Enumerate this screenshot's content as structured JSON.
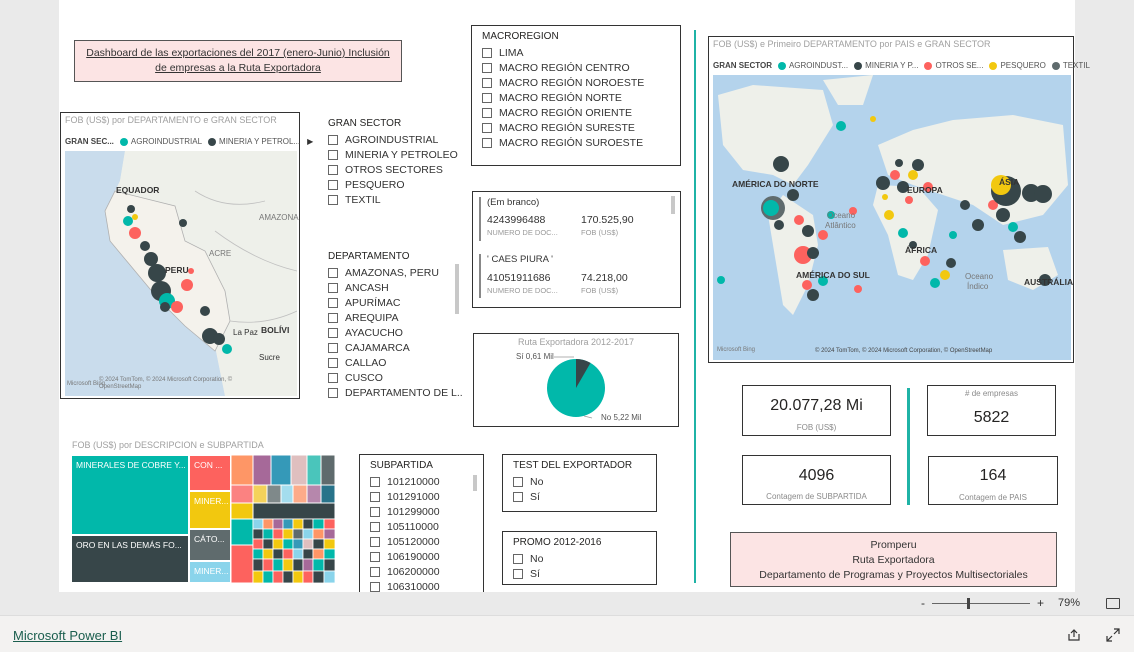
{
  "report": {
    "title_box": "Dashboard de las exportaciones del 2017 (enero-Junio) Inclusión de empresas a la Ruta Exportadora"
  },
  "dept_map": {
    "title": "FOB (US$) por DEPARTAMENTO e GRAN SECTOR",
    "legend_title": "GRAN SEC...",
    "legend": [
      {
        "label": "AGROINDUSTRIAL",
        "color": "#01b8aa"
      },
      {
        "label": "MINERIA Y PETROL...",
        "color": "#374649"
      }
    ],
    "labels": {
      "equador": "EQUADOR",
      "peru": "PERU",
      "bolivia": "BOLÍVI",
      "amazonas": "AMAZONA",
      "acre": "ACRE",
      "lapaz": "La Paz",
      "sucre": "Sucre",
      "lima": "Lima"
    },
    "copyright": "© 2024 TomTom, © 2024 Microsoft Corporation, © OpenStreetMap",
    "terms": "Terms",
    "brand": "Microsoft Bing"
  },
  "gran_sector": {
    "title": "GRAN SECTOR",
    "items": [
      "AGROINDUSTRIAL",
      "MINERIA Y PETROLEO",
      "OTROS SECTORES",
      "PESQUERO",
      "TEXTIL"
    ]
  },
  "departamento": {
    "title": "DEPARTAMENTO",
    "items": [
      "AMAZONAS, PERU",
      "ANCASH",
      "APURÍMAC",
      "AREQUIPA",
      "AYACUCHO",
      "CAJAMARCA",
      "CALLAO",
      "CUSCO",
      "DEPARTAMENTO DE L..."
    ]
  },
  "macroregion": {
    "title": "MACROREGION",
    "items": [
      "LIMA",
      "MACRO REGIÓN CENTRO",
      "MACRO REGIÓN NOROESTE",
      "MACRO REGIÓN NORTE",
      "MACRO REGIÓN ORIENTE",
      "MACRO REGIÓN SURESTE",
      "MACRO REGIÓN SUROESTE"
    ]
  },
  "company_list": {
    "groups": [
      {
        "header": "(Em branco)",
        "id": "4243996488",
        "id_label": "NUMERO DE DOC...",
        "fob": "170.525,90",
        "fob_label": "FOB (US$)"
      },
      {
        "header": "' CAES PIURA '",
        "id": "41051911686",
        "id_label": "NUMERO DE DOC...",
        "fob": "74.218,00",
        "fob_label": "FOB (US$)"
      }
    ]
  },
  "ruta_pie": {
    "title": "Ruta Exportadora 2012-2017",
    "label_si": "Sí 0,61 Mil",
    "label_no": "No 5,22 Mil",
    "colors": {
      "si": "#374649",
      "no": "#01b8aa"
    }
  },
  "world_map": {
    "title": "FOB (US$) e Primeiro DEPARTAMENTO por PAIS e GRAN SECTOR",
    "legend_title": "GRAN SECTOR",
    "legend": [
      {
        "label": "AGROINDUST...",
        "color": "#01b8aa"
      },
      {
        "label": "MINERIA Y P...",
        "color": "#374649"
      },
      {
        "label": "OTROS SE...",
        "color": "#fd625e"
      },
      {
        "label": "PESQUERO",
        "color": "#f2c80f"
      },
      {
        "label": "TEXTIL",
        "color": "#5f6b6d"
      }
    ],
    "labels": {
      "na": "AMÉRICA DO NORTE",
      "eu": "EUROPA",
      "asia": "ÁSIA",
      "ocean_atl": "Oceano",
      "ocean_atl2": "Atlântico",
      "africa": "ÁFRICA",
      "sa": "AMÉRICA DO SUL",
      "ocean_ind": "Oceano",
      "ocean_ind2": "Índico",
      "aus": "AUSTRÁLIA"
    },
    "copyright": "© 2024 TomTom, © 2024 Microsoft Corporation, © OpenStreetMap",
    "terms": "Terms",
    "brand": "Microsoft Bing"
  },
  "cards": {
    "fob": {
      "value": "20.077,28 Mi",
      "label": "FOB (US$)"
    },
    "empresas": {
      "value": "5822",
      "label": "# de empresas"
    },
    "subpartida": {
      "value": "4096",
      "label": "Contagem de SUBPARTIDA"
    },
    "pais": {
      "value": "164",
      "label": "Contagem de PAIS"
    }
  },
  "treemap": {
    "title": "FOB (US$) por DESCRIPCION e SUBPARTIDA",
    "labels": {
      "cobre": "MINERALES DE COBRE Y...",
      "oro": "ORO EN LAS DEMÁS FO...",
      "con": "CON ...",
      "miner1": "MINER...",
      "catodo": "CÁTO...",
      "miner2": "MINER..."
    }
  },
  "subpartida": {
    "title": "SUBPARTIDA",
    "items": [
      "101210000",
      "101291000",
      "101299000",
      "105110000",
      "105120000",
      "106190000",
      "106200000",
      "106310000"
    ]
  },
  "test_exportador": {
    "title": "TEST DEL EXPORTADOR",
    "items": [
      "No",
      "Sí"
    ]
  },
  "promo": {
    "title": "PROMO 2012-2016",
    "items": [
      "No",
      "Sí"
    ]
  },
  "promperu": {
    "line1": "Promperu",
    "line2": "Ruta Exportadora",
    "line3": "Departamento de Programas y Proyectos Multisectoriales"
  },
  "zoom": {
    "minus": "-",
    "plus": "+",
    "level": "79%"
  },
  "footer": {
    "brand": "Microsoft Power BI"
  }
}
